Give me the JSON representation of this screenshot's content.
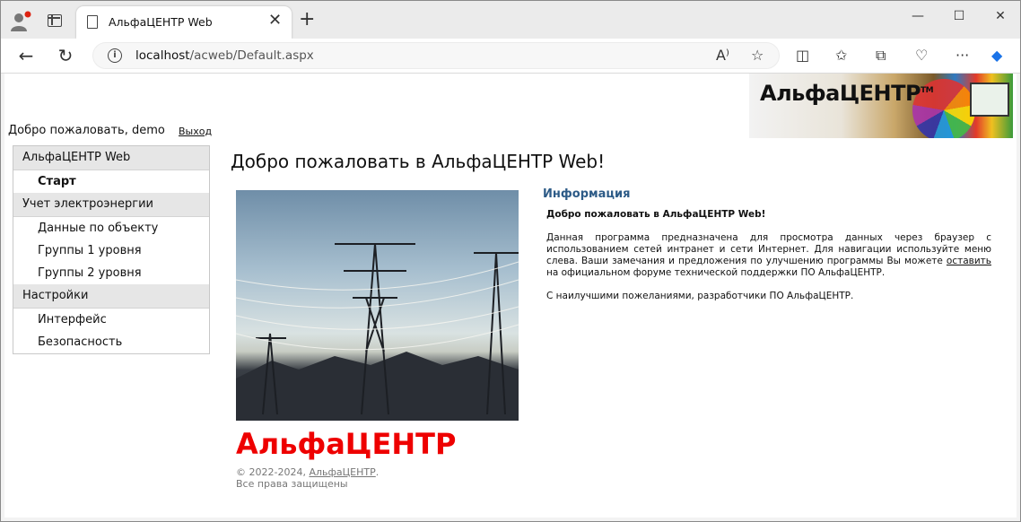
{
  "browser": {
    "tab_title": "АльфаЦЕНТР Web",
    "url_host": "localhost",
    "url_path": "/acweb/Default.aspx"
  },
  "banner": {
    "logo_text": "АльфаЦЕНТР",
    "tm": "TM"
  },
  "user": {
    "welcome": "Добро пожаловать, demo",
    "logout": "Выход"
  },
  "menu": {
    "sections": [
      {
        "label": "АльфаЦЕНТР Web",
        "items": [
          "Старт"
        ]
      },
      {
        "label": "Учет электроэнергии",
        "items": [
          "Данные по объекту",
          "Группы 1 уровня",
          "Группы 2 уровня"
        ]
      },
      {
        "label": "Настройки",
        "items": [
          "Интерфейс",
          "Безопасность"
        ]
      }
    ],
    "active_item": "Старт"
  },
  "main": {
    "title": "Добро пожаловать в АльфаЦЕНТР Web!",
    "brand": "АльфаЦЕНТР",
    "copyright_prefix": "© 2022-2024, ",
    "copyright_link": "АльфаЦЕНТР",
    "copyright_suffix": ".",
    "rights": "Все права защищены"
  },
  "info": {
    "heading": "Информация",
    "lead": "Добро пожаловать в АльфаЦЕНТР Web!",
    "para1": "Данная программа предназначена для просмотра данных через браузер с использованием сетей интранет и сети Интернет. Для навигации используйте меню слева. Ваши замечания и предложения по улучшению программы Вы можете ",
    "para1_link": "оставить",
    "para1_end": " на официальном форуме технической поддержки ПО АльфаЦЕНТР.",
    "para2": "С наилучшими пожеланиями, разработчики ПО АльфаЦЕНТР."
  },
  "colors": {
    "brand_red": "#ee0000",
    "info_heading": "#2d5b87"
  }
}
